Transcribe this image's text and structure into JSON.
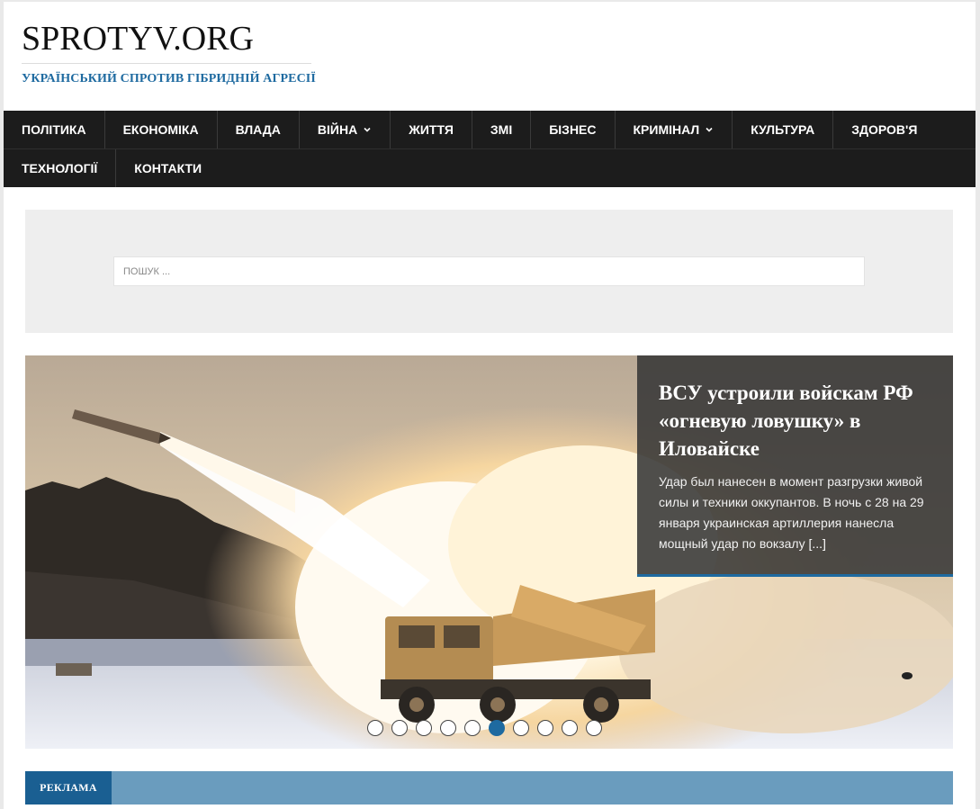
{
  "site": {
    "title": "SPROTYV.ORG",
    "tagline": "УКРАЇНСЬКИЙ СПРОТИВ ГІБРИДНІЙ АГРЕСІЇ"
  },
  "nav": {
    "row1": [
      {
        "label": "ПОЛІТИКА"
      },
      {
        "label": "ЕКОНОМІКА"
      },
      {
        "label": "ВЛАДА"
      },
      {
        "label": "ВІЙНА",
        "dropdown": true
      },
      {
        "label": "ЖИТТЯ"
      },
      {
        "label": "ЗМІ"
      },
      {
        "label": "БІЗНЕС"
      },
      {
        "label": "КРИМІНАЛ",
        "dropdown": true
      },
      {
        "label": "КУЛЬТУРА"
      },
      {
        "label": "ЗДОРОВ'Я"
      }
    ],
    "row2": [
      {
        "label": "ТЕХНОЛОГІЇ"
      },
      {
        "label": "КОНТАКТИ"
      }
    ]
  },
  "search": {
    "placeholder": "ПОШУК ..."
  },
  "slider": {
    "title": "ВСУ устроили войскам РФ «огневую ловушку» в Иловайске",
    "excerpt": "Удар был нанесен в момент разгрузки живой силы и техники оккупантов. В ночь с 28 на 29 января украинская артиллерия нанесла мощный удар по вокзалу",
    "more": "[...]",
    "slide_count": 10,
    "active_slide": 6
  },
  "ad": {
    "label": "РЕКЛАМА"
  },
  "colors": {
    "accent": "#1e6aa0",
    "nav_bg": "#1c1c1c",
    "ad_bar": "#6a9cbe"
  }
}
